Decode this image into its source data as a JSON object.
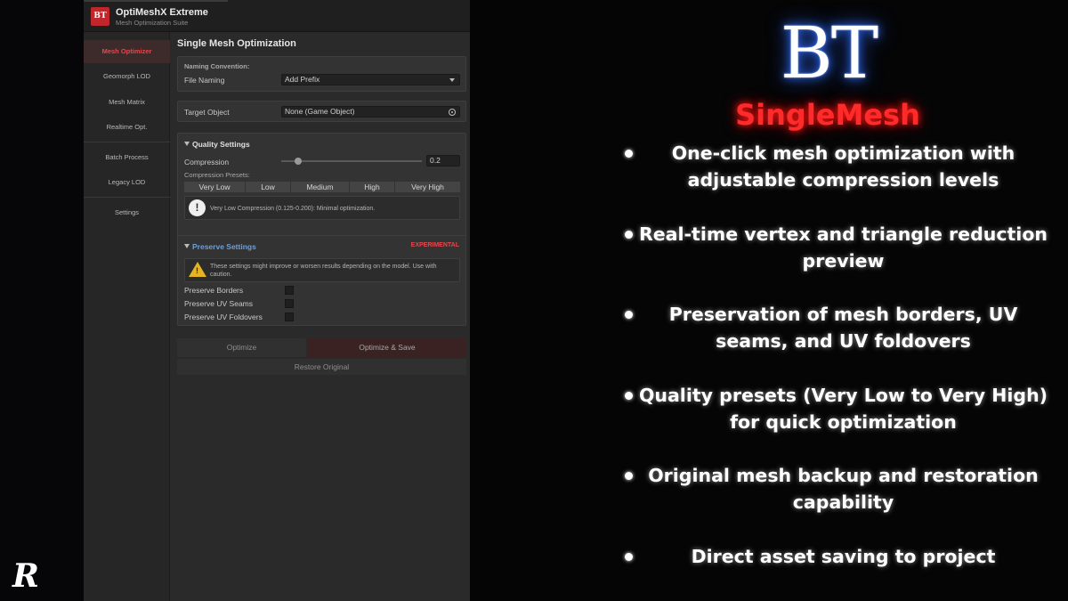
{
  "app": {
    "logo_text": "BT",
    "title": "OptiMeshX Extreme",
    "subtitle": "Mesh Optimization Suite"
  },
  "sidebar": {
    "items": [
      {
        "label": "Mesh Optimizer"
      },
      {
        "label": "Geomorph LOD"
      },
      {
        "label": "Mesh Matrix"
      },
      {
        "label": "Realtime Opt."
      },
      {
        "label": "Batch Process"
      },
      {
        "label": "Legacy LOD"
      },
      {
        "label": "Settings"
      }
    ]
  },
  "main": {
    "title": "Single Mesh Optimization",
    "naming": {
      "section_label": "Naming Convention:",
      "field_label": "File Naming",
      "value": "Add Prefix"
    },
    "target": {
      "label": "Target Object",
      "value": "None (Game Object)"
    },
    "quality": {
      "header": "Quality Settings",
      "compression_label": "Compression",
      "compression_value": "0.2",
      "slider_fraction": 0.12,
      "presets_label": "Compression Presets:",
      "presets": [
        "Very Low",
        "Low",
        "Medium",
        "High",
        "Very High"
      ],
      "info": "Very Low Compression (0.125-0.200): Minimal optimization."
    },
    "preserve": {
      "header": "Preserve Settings",
      "badge": "EXPERIMENTAL",
      "warning": "These settings might improve or worsen results depending on the model. Use with caution.",
      "options": [
        "Preserve Borders",
        "Preserve UV Seams",
        "Preserve UV Foldovers"
      ]
    },
    "buttons": {
      "optimize": "Optimize",
      "optimize_save": "Optimize & Save",
      "restore": "Restore Original"
    }
  },
  "promo": {
    "logo": "BT",
    "product": "SingleMesh",
    "features": [
      {
        "line1": "One-click mesh optimization with",
        "line2": "adjustable compression levels"
      },
      {
        "line1": "Real-time vertex and triangle reduction",
        "line2": "preview"
      },
      {
        "line1": "Preservation of mesh borders, UV",
        "line2": "seams, and UV foldovers"
      },
      {
        "line1": "Quality presets (Very Low to Very High)",
        "line2": "for quick optimization"
      },
      {
        "line1": "Original mesh backup and restoration",
        "line2": "capability"
      },
      {
        "line1": "Direct asset saving to project",
        "line2": ""
      }
    ],
    "corner_logo": "R"
  },
  "colors": {
    "accent_red": "#e04a4f",
    "brand_red": "#c0272d",
    "preserve_blue": "#6a9fe0",
    "warning_yellow": "#e6b422"
  }
}
